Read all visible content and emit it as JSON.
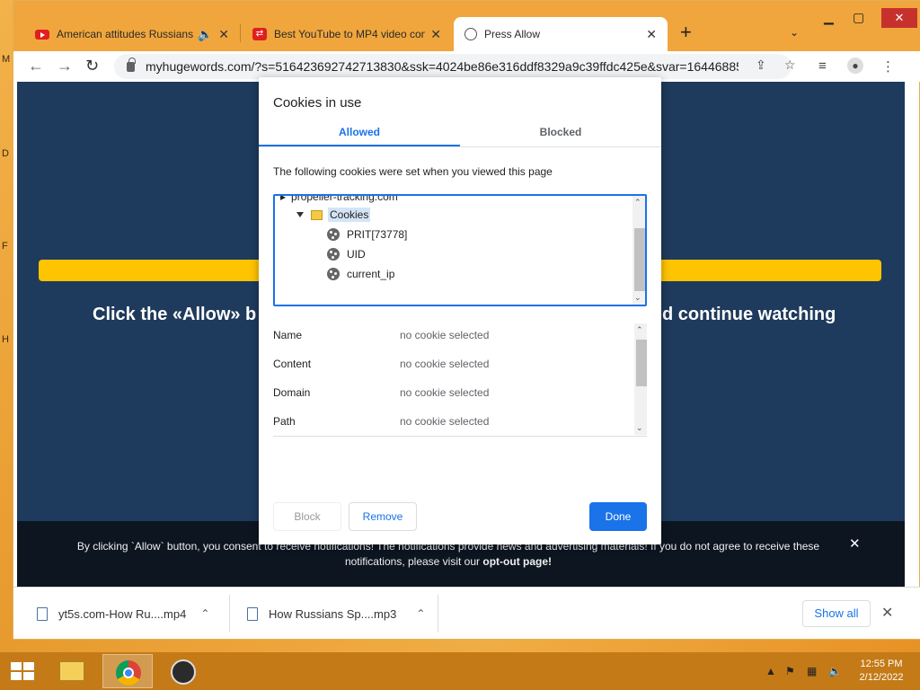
{
  "browser": {
    "tabs": [
      {
        "title": "American attitudes Russians",
        "icon": "youtube-icon"
      },
      {
        "title": "Best YouTube to MP4 video conv",
        "icon": "converter-icon"
      },
      {
        "title": "Press Allow",
        "icon": "globe-icon"
      }
    ],
    "active_tab_index": 2,
    "url": "myhugewords.com/?s=516423692742713830&ssk=4024be86e316ddf8329a9c39ffdc425e&svar=16446885..."
  },
  "page": {
    "headline_left": "Click the «Allow» b",
    "headline_right": "d continue watching",
    "consent_line1_a": "By clicking `Allow` button, you consent to receive notifications! The notifications provide news and advertising materials! If you do not agree to receive these",
    "consent_line2_a": "notifications, please visit our ",
    "consent_link": "opt-out page",
    "consent_line2_b": "!"
  },
  "dialog": {
    "title": "Cookies in use",
    "tab_allowed": "Allowed",
    "tab_blocked": "Blocked",
    "description": "The following cookies were set when you viewed this page",
    "tree": {
      "domain": "propeller-tracking.com",
      "folder": "Cookies",
      "cookies": [
        "PRIT[73778]",
        "UID",
        "current_ip"
      ]
    },
    "details": [
      {
        "label": "Name",
        "value": "no cookie selected"
      },
      {
        "label": "Content",
        "value": "no cookie selected"
      },
      {
        "label": "Domain",
        "value": "no cookie selected"
      },
      {
        "label": "Path",
        "value": "no cookie selected"
      }
    ],
    "btn_block": "Block",
    "btn_remove": "Remove",
    "btn_done": "Done"
  },
  "downloads": {
    "items": [
      {
        "name": "yt5s.com-How Ru....mp4"
      },
      {
        "name": "How Russians Sp....mp3"
      }
    ],
    "show_all": "Show all"
  },
  "taskbar": {
    "time": "12:55 PM",
    "date": "2/12/2022"
  },
  "colors": {
    "accent": "#1a73e8",
    "page_bg": "#1e3a5c",
    "progress": "#ffc400",
    "desktop": "#e9a13a"
  }
}
